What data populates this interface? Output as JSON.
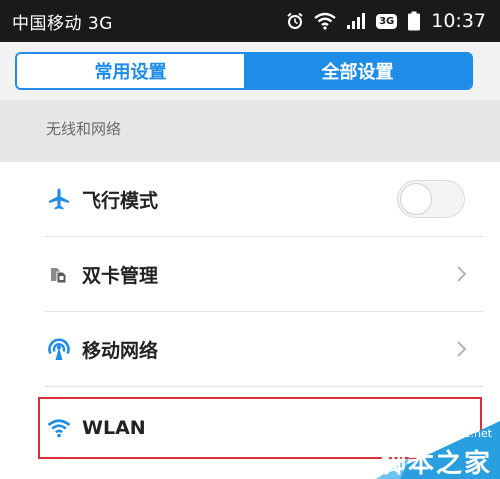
{
  "status_bar": {
    "carrier": "中国移动 3G",
    "network_badge": "3G",
    "time": "10:37",
    "icons": [
      "alarm-icon",
      "wifi-icon",
      "signal-icon",
      "battery-icon"
    ]
  },
  "tabs": {
    "common_label": "常用设置",
    "all_label": "全部设置",
    "active_tab": "全部设置"
  },
  "section": {
    "title": "无线和网络"
  },
  "settings": {
    "items": [
      {
        "label": "飞行模式",
        "icon": "airplane-icon",
        "control": "toggle",
        "toggle_on": false
      },
      {
        "label": "双卡管理",
        "icon": "dual-sim-icon",
        "control": "chevron"
      },
      {
        "label": "移动网络",
        "icon": "mobile-network-icon",
        "control": "chevron"
      },
      {
        "label": "WLAN",
        "icon": "wifi-icon",
        "control": "chevron",
        "highlighted": true
      }
    ]
  },
  "colors": {
    "accent": "#1f8ce8",
    "highlight_border": "#d9303a",
    "status_bar_bg": "#1a1a1a"
  },
  "watermark": {
    "site": "jb51.net",
    "brand": "脚本之家"
  }
}
